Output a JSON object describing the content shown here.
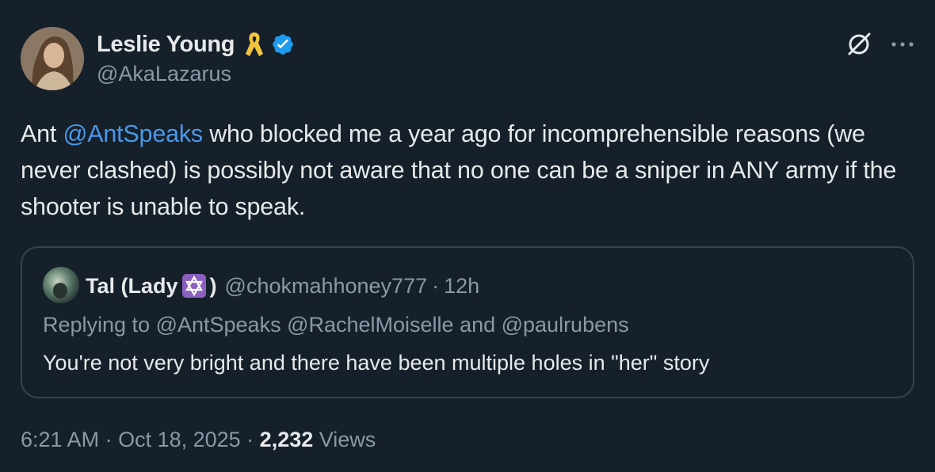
{
  "author": {
    "display_name": "Leslie Young",
    "handle": "@AkaLazarus",
    "icons": [
      "yellow-ribbon-icon",
      "verified-badge-icon"
    ],
    "verified_color": "#1d9bf0"
  },
  "actions": {
    "grok_icon": "grok-icon",
    "more_icon": "more-icon"
  },
  "tweet": {
    "text_before": "Ant ",
    "mention": "@AntSpeaks",
    "text_after": " who blocked me a year ago for incomprehensible reasons (we never clashed) is possibly not aware that no one can be a sniper in ANY army if the shooter is unable to speak."
  },
  "quote": {
    "display_name": "Tal (Lady",
    "display_name_close": ")",
    "name_emoji": "star-of-david-icon",
    "handle": "@chokmahhoney777",
    "separator": "·",
    "time": "12h",
    "reply_line": "Replying to @AntSpeaks @RachelMoiselle and @paulrubens",
    "text": "You're not very bright and there have been multiple holes in \"her\" story"
  },
  "meta": {
    "time": "6:21 AM",
    "separator1": " · ",
    "date": "Oct 18, 2025",
    "separator2": " · ",
    "views_count": "2,232",
    "views_label": " Views"
  },
  "colors": {
    "background": "#15202b",
    "text": "#e7e9ea",
    "secondary": "#8b98a5",
    "link": "#4a99e9",
    "border": "#38444d"
  }
}
